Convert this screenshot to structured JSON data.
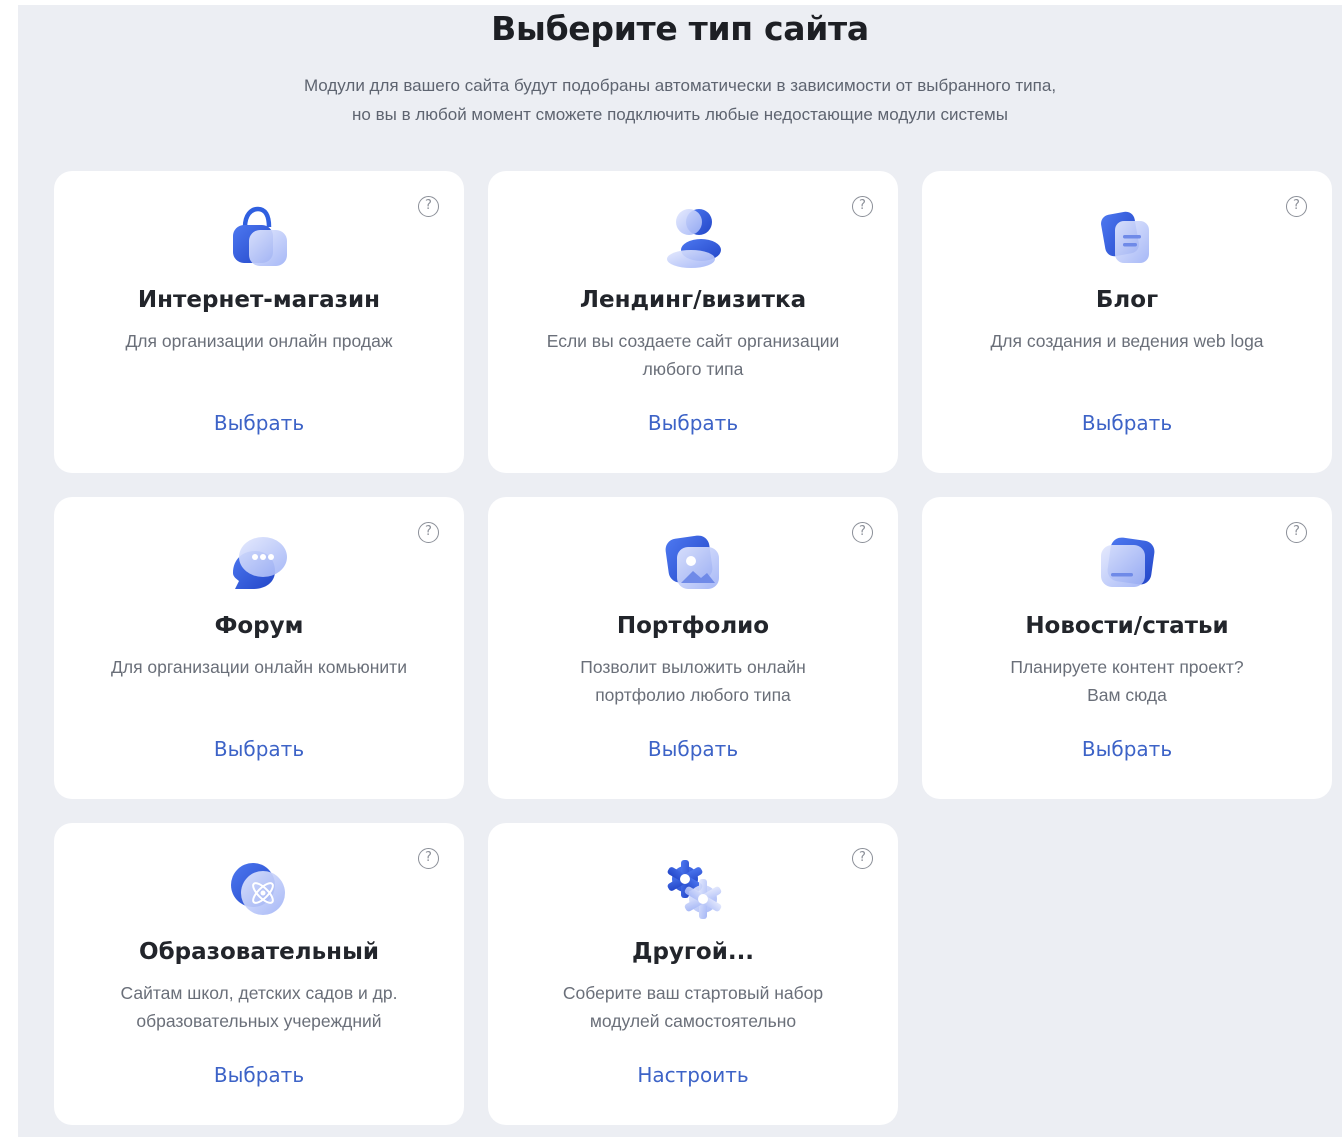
{
  "page": {
    "title": "Выберите тип сайта",
    "subtitle_line1": "Модули для вашего сайта будут подобраны автоматически в зависимости от выбранного типа,",
    "subtitle_line2": "но вы в любой момент сможете подключить любые недостающие модули системы"
  },
  "help_glyph": "?",
  "colors": {
    "background": "#eceef3",
    "card": "#ffffff",
    "accent": "#3d63c7",
    "icon_blue": "#2f5fe0",
    "icon_light": "#aebdf8"
  },
  "cards": [
    {
      "icon": "shopping-bag-icon",
      "title": "Интернет-магазин",
      "desc_line1": "Для организации онлайн продаж",
      "desc_line2": "",
      "action": "Выбрать"
    },
    {
      "icon": "person-icon",
      "title": "Лендинг/визитка",
      "desc_line1": "Если вы создаете сайт организации",
      "desc_line2": "любого типа",
      "action": "Выбрать"
    },
    {
      "icon": "document-icon",
      "title": "Блог",
      "desc_line1": "Для создания и ведения web loga",
      "desc_line2": "",
      "action": "Выбрать"
    },
    {
      "icon": "chat-bubble-icon",
      "title": "Форум",
      "desc_line1": "Для организации онлайн комьюнити",
      "desc_line2": "",
      "action": "Выбрать"
    },
    {
      "icon": "image-icon",
      "title": "Портфолио",
      "desc_line1": "Позволит выложить онлайн",
      "desc_line2": "портфолио любого типа",
      "action": "Выбрать"
    },
    {
      "icon": "news-card-icon",
      "title": "Новости/статьи",
      "desc_line1": "Планируете контент проект?",
      "desc_line2": "Вам сюда",
      "action": "Выбрать"
    },
    {
      "icon": "atom-icon",
      "title": "Образовательный",
      "desc_line1": "Сайтам школ, детских садов и др.",
      "desc_line2": "образовательных учереждний",
      "action": "Выбрать"
    },
    {
      "icon": "gears-icon",
      "title": "Другой...",
      "desc_line1": "Соберите ваш стартовый набор",
      "desc_line2": "модулей самостоятельно",
      "action": "Настроить"
    }
  ]
}
